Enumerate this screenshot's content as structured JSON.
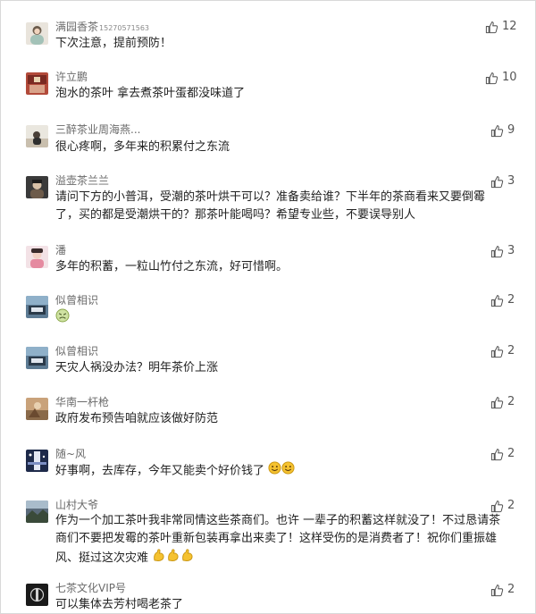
{
  "comments": [
    {
      "name": "满园香茶",
      "phone": "15270571563",
      "text": "下次注意，提前预防！",
      "likes": "12"
    },
    {
      "name": "许立鹏",
      "text": "泡水的茶叶 拿去煮茶叶蛋都没味道了",
      "likes": "10"
    },
    {
      "name": "三醉茶业周海燕...",
      "text": "很心疼啊，多年来的积累付之东流",
      "likes": "9"
    },
    {
      "name": "溢壶茶兰兰",
      "text_line1": "请问下方的小普洱，受潮的茶叶烘干可以？准备卖给谁？下半年的茶商看来又要倒霉",
      "text_line2": "了，买的都是受潮烘干的？那茶叶能喝吗？希望专业些，不要误导别人",
      "likes": "3"
    },
    {
      "name": "潘",
      "text": "多年的积蓄，一粒山竹付之东流，好可惜啊。",
      "likes": "3"
    },
    {
      "name": "似曾相识",
      "emoji": "sick-face-emoji",
      "likes": "2"
    },
    {
      "name": "似曾相识",
      "text": "天灾人祸没办法？明年茶价上涨",
      "likes": "2"
    },
    {
      "name": "华南一杆枪",
      "text": "政府发布预告咱就应该做好防范",
      "likes": "2"
    },
    {
      "name": "随~风",
      "text": "好事啊，去库存，今年又能卖个好价钱了",
      "emoji": "smile-emoji",
      "likes": "2"
    },
    {
      "name": "山村大爷",
      "text_line1": "作为一个加工茶叶我非常同情这些茶商们。也许 一辈子的积蓄这样就没了！不过恳请茶",
      "text_line2": "商们不要把发霉的茶叶重新包装再拿出来卖了！这样受伤的是消费者了！祝你们重振雄",
      "text_line3": "风、挺过这次灾难",
      "emoji": "strong-arm-emoji",
      "likes": "2"
    },
    {
      "name": "七茶文化VIP号",
      "text": "可以集体去芳村喝老茶了",
      "likes": "2"
    }
  ],
  "icons": {
    "like": "thumbs-up-icon"
  },
  "colors": {
    "name": "#6a6a6a",
    "text": "#222222",
    "like": "#555555",
    "emoji_yellow": "#f5c230"
  }
}
